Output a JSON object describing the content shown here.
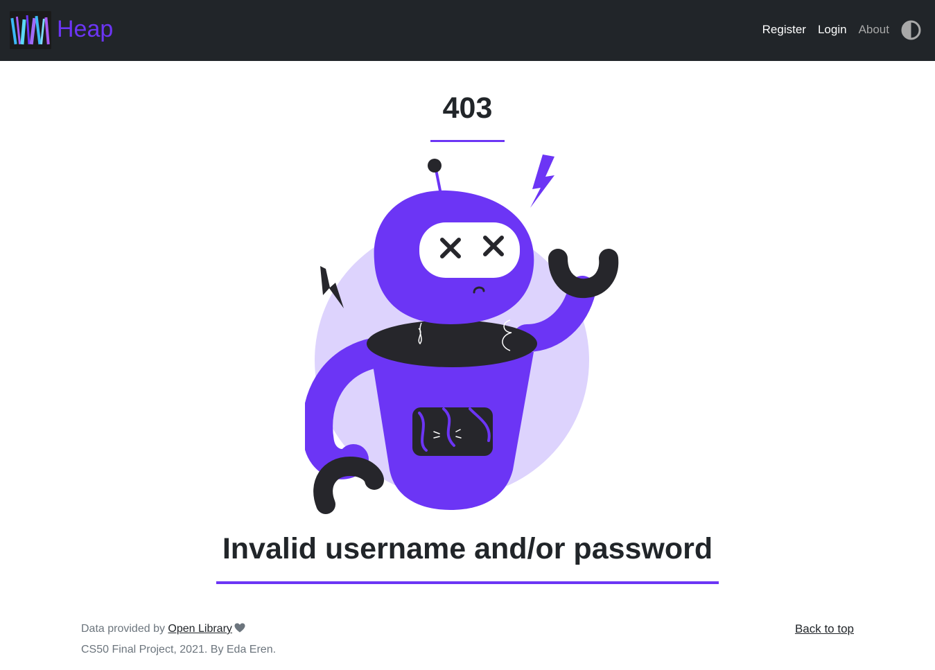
{
  "navbar": {
    "brand_name": "Heap",
    "links": [
      {
        "label": "Register"
      },
      {
        "label": "Login"
      },
      {
        "label": "About"
      }
    ],
    "theme_toggle_icon": "contrast-half-circle-icon"
  },
  "error": {
    "code": "403",
    "message": "Invalid username and/or password"
  },
  "footer": {
    "credit_prefix": "Data provided by ",
    "credit_link": "Open Library",
    "heart_icon": "heart-icon",
    "project": "CS50 Final Project, 2021. By Eda Eren.",
    "back_to_top": "Back to top"
  },
  "colors": {
    "accent": "#6c35f5",
    "navbar_bg": "#212529",
    "text": "#212529",
    "muted_text": "#6c757d",
    "robot_bg_circle": "#ddd3fd",
    "robot_dark": "#26262b"
  }
}
